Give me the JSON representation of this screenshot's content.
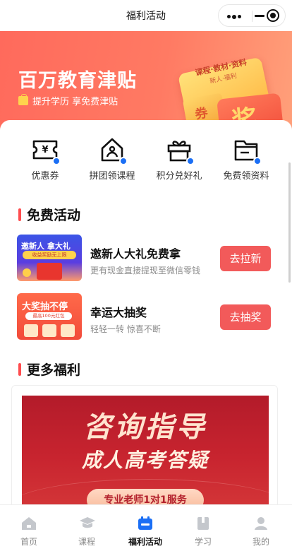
{
  "navbar": {
    "title": "福利活动"
  },
  "hero": {
    "title": "百万教育津贴",
    "subtitle": "提升学历 享免费津贴",
    "card_line1": "课程·教材·资料",
    "card_line2": "新人·福利",
    "coupon": "券",
    "prize": "奖"
  },
  "quick_actions": [
    {
      "label": "优惠券",
      "icon": "coupon-icon"
    },
    {
      "label": "拼团领课程",
      "icon": "group-buy-icon"
    },
    {
      "label": "积分兑好礼",
      "icon": "gift-icon"
    },
    {
      "label": "免费领资料",
      "icon": "folder-icon"
    }
  ],
  "free_section": {
    "title": "免费活动"
  },
  "activities": [
    {
      "title": "邀新人大礼免费拿",
      "desc": "更有现金直接提现至微信零钱",
      "button": "去拉新",
      "thumb_line1": "邀新人 拿大礼",
      "thumb_line2": "收益奖励无上限"
    },
    {
      "title": "幸运大抽奖",
      "desc": "轻轻一转 惊喜不断",
      "button": "去抽奖",
      "thumb_line1": "大奖抽不停",
      "thumb_line2": "最高100元红包"
    }
  ],
  "more_section": {
    "title": "更多福利"
  },
  "poster": {
    "line1": "咨询指导",
    "line2": "成人高考答疑",
    "line3": "专业老师1对1服务"
  },
  "tabbar": [
    {
      "label": "首页",
      "icon": "home-icon",
      "active": false
    },
    {
      "label": "课程",
      "icon": "course-icon",
      "active": false
    },
    {
      "label": "福利活动",
      "icon": "welfare-icon",
      "active": true
    },
    {
      "label": "学习",
      "icon": "study-icon",
      "active": false
    },
    {
      "label": "我的",
      "icon": "profile-icon",
      "active": false
    }
  ],
  "colors": {
    "accent": "#f25a5a",
    "active_tab": "#1b6ff5",
    "hero_start": "#ff6a5c",
    "hero_end": "#ffa07a"
  }
}
